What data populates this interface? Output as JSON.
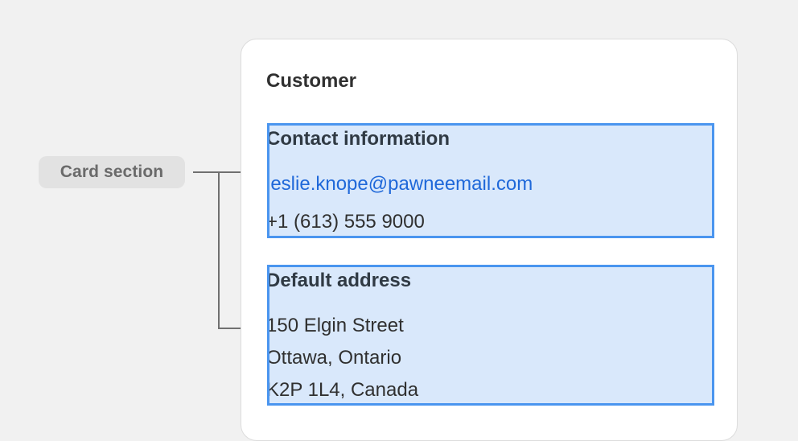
{
  "annotation": {
    "label": "Card section"
  },
  "card": {
    "title": "Customer",
    "contact": {
      "heading": "Contact information",
      "email": "leslie.knope@pawneemail.com",
      "phone": "+1 (613) 555 9000"
    },
    "address": {
      "heading": "Default address",
      "lines": [
        "150 Elgin Street",
        "Ottawa, Ontario",
        "K2P 1L4, Canada"
      ]
    }
  },
  "colors": {
    "page_background": "#f1f1f1",
    "section_fill": "#d9e8fb",
    "section_border": "#4a95ef",
    "link": "#1f68d9"
  }
}
